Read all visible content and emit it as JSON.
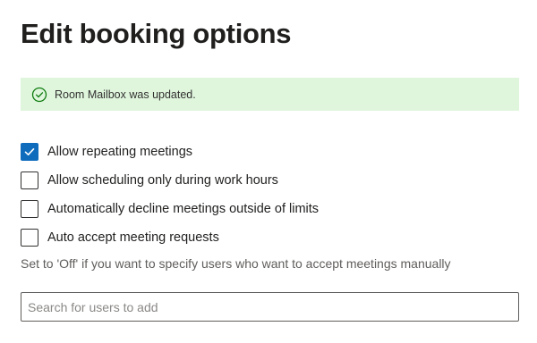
{
  "page": {
    "title": "Edit booking options"
  },
  "notification": {
    "icon": "check-circle-icon",
    "message": "Room Mailbox was updated.",
    "background_color": "#dff6dd",
    "icon_color": "#107c10"
  },
  "options": [
    {
      "label": "Allow repeating meetings",
      "checked": true
    },
    {
      "label": "Allow scheduling only during work hours",
      "checked": false
    },
    {
      "label": "Automatically decline meetings outside of limits",
      "checked": false
    },
    {
      "label": "Auto accept meeting requests",
      "checked": false
    }
  ],
  "hint": "Set to 'Off' if you want to specify users who want to accept meetings manually",
  "search": {
    "placeholder": "Search for users to add",
    "value": ""
  },
  "colors": {
    "accent": "#0f6cbd"
  }
}
